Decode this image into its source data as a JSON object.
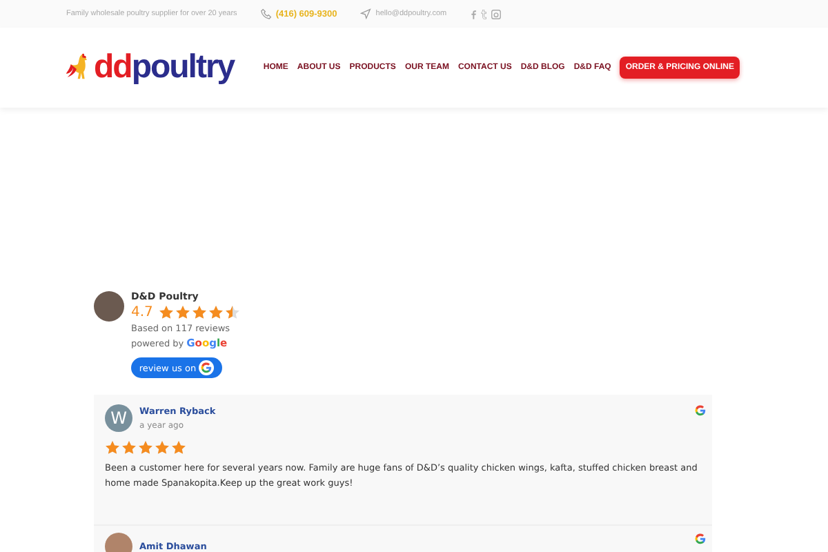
{
  "top_bar": {
    "tagline": "Family wholesale poultry supplier for over 20 years",
    "phone": "(416) 609-9300",
    "email": "hello@ddpoultry.com"
  },
  "header": {
    "logo": {
      "part_1": "dd",
      "part_2": "poultry"
    },
    "nav": [
      "HOME",
      "ABOUT US",
      "PRODUCTS",
      "OUR TEAM",
      "CONTACT US",
      "D&D BLOG",
      "D&D FAQ"
    ],
    "cta": "ORDER & PRICING ONLINE"
  },
  "summary": {
    "name": "D&D Poultry",
    "rating": "4.7",
    "stars": 4.5,
    "based_on": "Based on 117 reviews",
    "powered_by": "powered by",
    "google_word": "Google",
    "review_button": "review us on"
  },
  "reviews": [
    {
      "author": "Warren Ryback",
      "avatar_letter": "W",
      "time": "a year ago",
      "stars": 5,
      "text": "Been a customer here for several years now. Family are huge fans of D&D’s quality chicken wings, kafta, stuffed chicken breast and home made Spanakopita.Keep up the great work guys!"
    },
    {
      "author": "Amit Dhawan"
    }
  ]
}
